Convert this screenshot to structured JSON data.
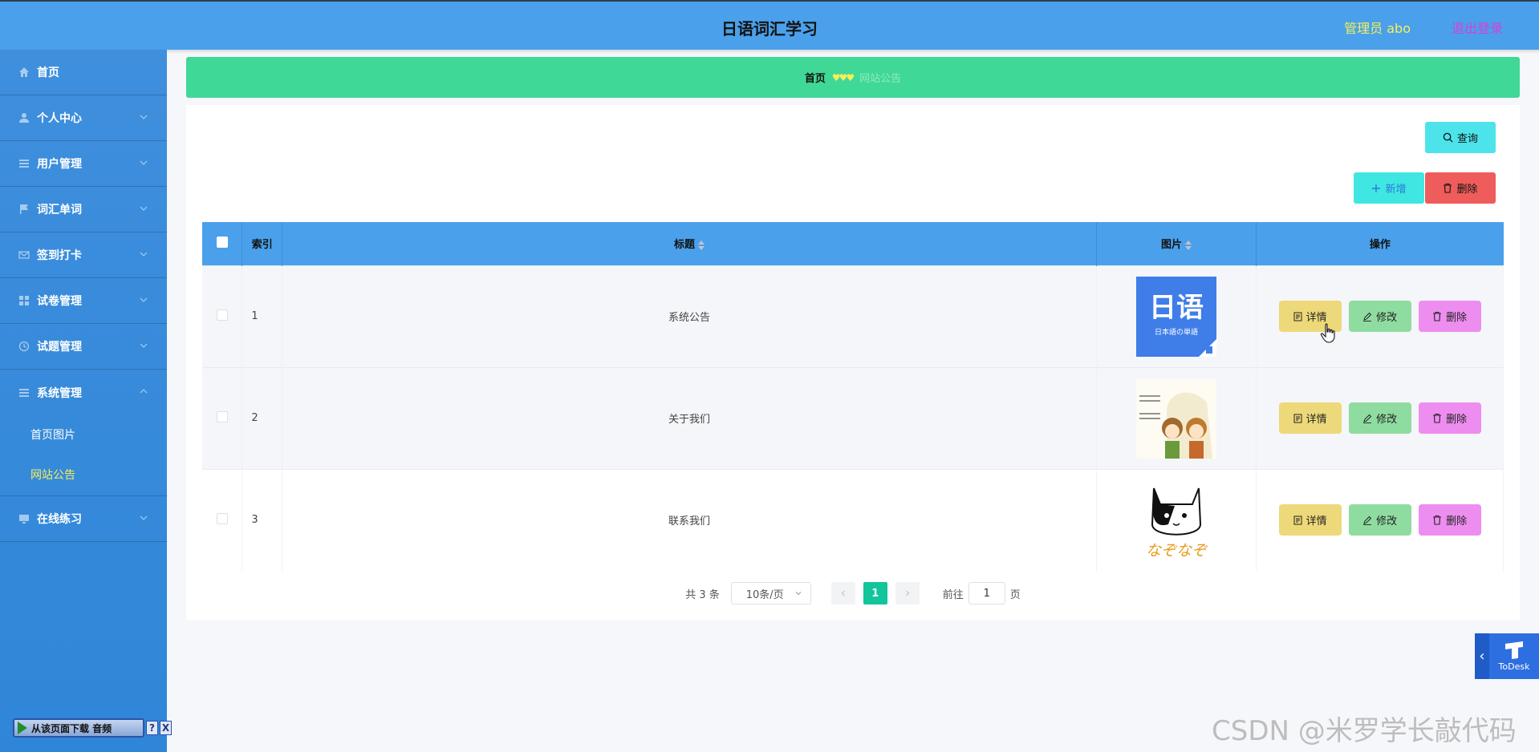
{
  "header": {
    "title": "日语词汇学习",
    "admin_user": "管理员 abo",
    "logout": "退出登录"
  },
  "sidebar": {
    "items": [
      {
        "label": "首页",
        "icon": "home-icon"
      },
      {
        "label": "个人中心",
        "icon": "user-icon"
      },
      {
        "label": "用户管理",
        "icon": "menu-lines-icon"
      },
      {
        "label": "词汇单词",
        "icon": "flag-icon"
      },
      {
        "label": "签到打卡",
        "icon": "mail-icon"
      },
      {
        "label": "试卷管理",
        "icon": "grid-icon"
      },
      {
        "label": "试题管理",
        "icon": "clock-icon"
      },
      {
        "label": "系统管理",
        "icon": "menu-lines-icon"
      }
    ],
    "system_sub": [
      {
        "label": "首页图片"
      },
      {
        "label": "网站公告"
      }
    ],
    "after": {
      "label": "在线练习",
      "icon": "monitor-icon"
    }
  },
  "breadcrumb": {
    "home": "首页",
    "current": "网站公告"
  },
  "toolbar": {
    "query": "查询",
    "add": "新增",
    "delete": "删除"
  },
  "table": {
    "headers": [
      "索引",
      "标题",
      "图片",
      "操作"
    ],
    "rows": [
      {
        "index": "1",
        "title": "系统公告",
        "image_text": "日语",
        "image_caption": "日本語の単語"
      },
      {
        "index": "2",
        "title": "关于我们"
      },
      {
        "index": "3",
        "title": "联系我们",
        "image_text": "なぞなぞ"
      }
    ],
    "actions": {
      "detail": "详情",
      "edit": "修改",
      "delete": "删除"
    }
  },
  "pagination": {
    "total": "共 3 条",
    "page_size": "10条/页",
    "current_page": "1",
    "goto_label": "前往",
    "goto_value": "1",
    "page_unit": "页"
  },
  "todesk": {
    "label": "ToDesk"
  },
  "download_bar": {
    "label": "从该页面下载 音频",
    "help": "?",
    "close": "X"
  },
  "watermark": "CSDN @米罗学长敲代码",
  "colors": {
    "header_bg": "#4aa0ea",
    "sidebar_bg": "#3f8fdd",
    "breadcrumb_bg": "#40d896",
    "accent_yellow": "#f6ef5a",
    "logout_color": "#d63fd6",
    "page_active": "#13c59a"
  }
}
